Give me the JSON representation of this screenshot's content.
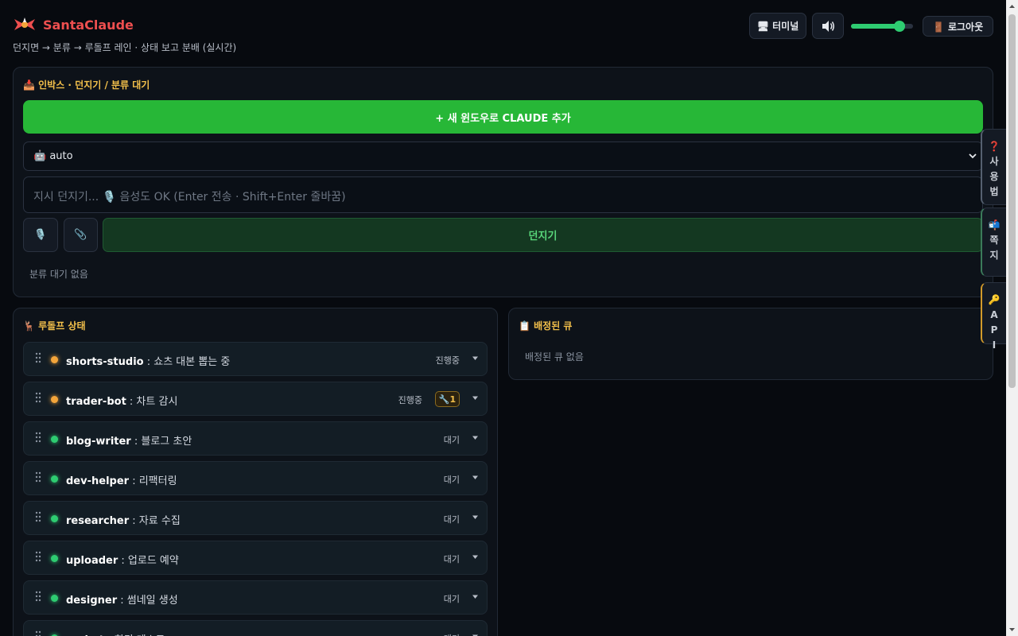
{
  "app": {
    "name": "SantaClaude",
    "subtitle": "던지면 → 분류 → 루돌프 레인 · 상태 보고 분배 (실시간)"
  },
  "header": {
    "terminal_label": "🖥 터미널",
    "sound_icon": "speaker-icon",
    "volume_level": 0.78,
    "logout_label": "🚪 로그아웃"
  },
  "inbox": {
    "title": "📥 인박스 · 던지기 / 분류 대기",
    "add_button": "+ 새 윈도우로 CLAUDE 추가",
    "model_select_value": "🤖 auto",
    "input_placeholder": "지시 던지기... 🎙️ 음성도 OK (Enter 전송 · Shift+Enter 줄바꿈)",
    "mic_icon": "🎙️",
    "clip_icon": "📎",
    "throw_button": "던지기",
    "empty_text": "분류 대기 없음"
  },
  "rudolph": {
    "title": "🦌 루돌프 상태",
    "lanes": [
      {
        "name": "shorts-studio",
        "task": " : 쇼츠 대본 뽑는 중",
        "status": "진행중",
        "state": "busy"
      },
      {
        "name": "trader-bot",
        "task": " : 차트 감시",
        "status": "진행중",
        "state": "busy",
        "badge": "🔧1"
      },
      {
        "name": "blog-writer",
        "task": " : 블로그 초안",
        "status": "대기",
        "state": "idle"
      },
      {
        "name": "dev-helper",
        "task": " : 리팩터링",
        "status": "대기",
        "state": "idle"
      },
      {
        "name": "researcher",
        "task": " : 자료 수집",
        "status": "대기",
        "state": "idle"
      },
      {
        "name": "uploader",
        "task": " : 업로드 예약",
        "status": "대기",
        "state": "idle"
      },
      {
        "name": "designer",
        "task": " : 썸네일 생성",
        "status": "대기",
        "state": "idle"
      },
      {
        "name": "qa-bot",
        "task": " : 회귀 테스트",
        "status": "대기",
        "state": "idle"
      }
    ]
  },
  "queue": {
    "title": "📋 배정된 큐",
    "empty_text": "배정된 큐 없음"
  },
  "side_tabs": {
    "help": {
      "icon": "❓",
      "chars": [
        "사",
        "용",
        "법"
      ]
    },
    "messages": {
      "icon": "📬",
      "chars": [
        "쪽",
        "지"
      ]
    },
    "api": {
      "icon": "🔑",
      "chars": [
        "A",
        "P",
        "I"
      ]
    }
  },
  "colors": {
    "brand": "#ee4f4f",
    "accent_green": "#27b737",
    "section_title": "#f3c04b",
    "busy": "#f3a53b",
    "idle": "#2ecc71"
  }
}
